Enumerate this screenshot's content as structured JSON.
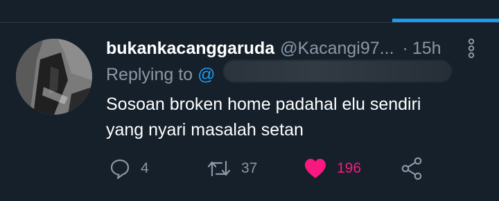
{
  "tweet": {
    "display_name": "bukankacanggaruda",
    "handle": "@Kacangi97...",
    "separator": "·",
    "time": "15h",
    "replying_prefix": "Replying to",
    "replying_at": "@",
    "text_line_1": "Sosoan broken home padahal elu sendiri",
    "text_line_2": "yang nyari masalah setan"
  },
  "actions": {
    "replies": "4",
    "retweets": "37",
    "likes": "196",
    "liked": true
  },
  "icons": {
    "avatar": "profile-photo",
    "more": "more-vertical-icon",
    "reply": "reply-icon",
    "retweet": "retweet-icon",
    "like": "heart-icon",
    "share": "share-icon"
  },
  "colors": {
    "background": "#15202b",
    "accent": "#1d9bf0",
    "muted": "#8b98a5",
    "like": "#f91880"
  }
}
